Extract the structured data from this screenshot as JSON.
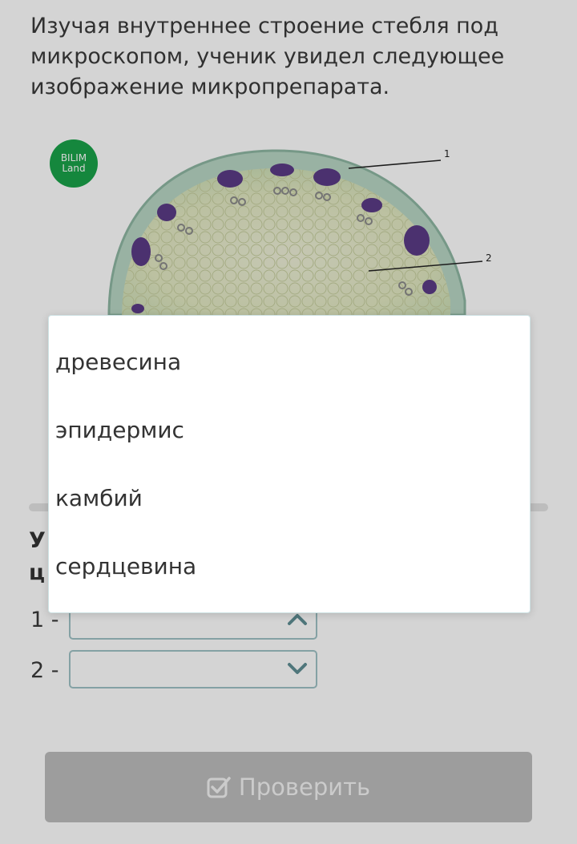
{
  "question": {
    "text": "Изучая внутреннее строение стебля под микроскопом, ученик увидел следующее изображение микропрепарата."
  },
  "figure": {
    "logo_line1": "BILIM",
    "logo_line2": "Land",
    "label_1": "1",
    "label_2": "2"
  },
  "instruction": {
    "line1_visible": "У",
    "line2_visible": "ц"
  },
  "answers": [
    {
      "label": "1 -",
      "value": "",
      "chevron": "chevron-up-icon",
      "state": "open"
    },
    {
      "label": "2 -",
      "value": "",
      "chevron": "chevron-down-icon",
      "state": "closed"
    }
  ],
  "dropdown": {
    "options": [
      "древесина",
      "эпидермис",
      "камбий",
      "сердцевина"
    ]
  },
  "check_button": {
    "label": "Проверить",
    "icon": "checkbox-icon"
  },
  "colors": {
    "logo_green": "#1aa34a",
    "select_border": "#9fc2c6",
    "button_bg": "#bdbdbd"
  }
}
